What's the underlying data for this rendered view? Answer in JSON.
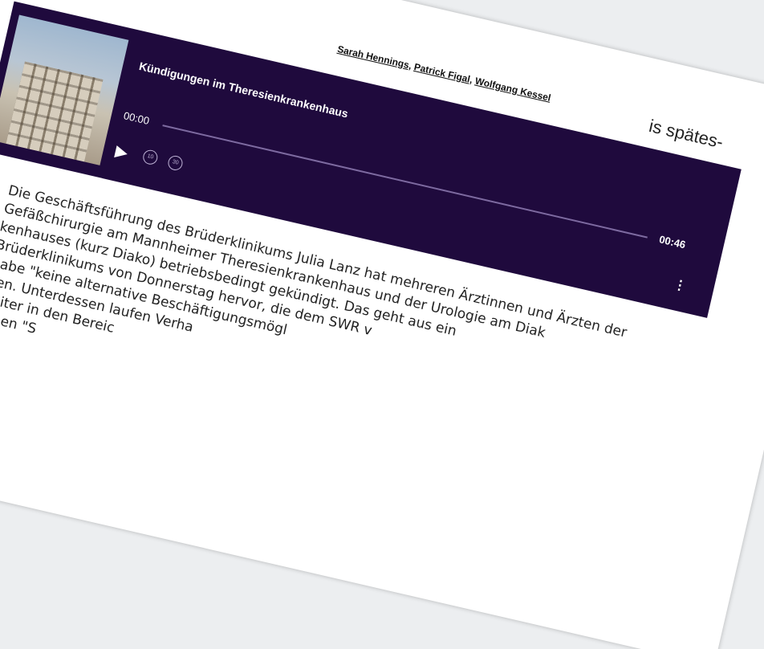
{
  "byline": {
    "authors": [
      "Sarah Hennings",
      "Patrick Figal",
      "Wolfgang Kessel"
    ],
    "separator": ", ",
    "side_text": "is spätes-"
  },
  "player": {
    "title": "Kündigungen im Theresienkrankenhaus",
    "current_time": "00:00",
    "total_time": "00:46",
    "progress": 0,
    "play_icon": "play-icon",
    "rewind_label": "10",
    "forward_label": "30",
    "more_icon": "more-vertical-icon",
    "colors": {
      "background": "#1f0a3d",
      "track": "#7d6aa0",
      "text": "#ffffff"
    }
  },
  "article": {
    "lines": [
      "Die Geschäftsführung des Brüderklinikums Julia Lanz hat mehreren Ärztinnen und Ärzten der",
      "Gefäßchirurgie am Mannheimer Theresienkrankenhaus und der Urologie am Diak",
      "kenhauses (kurz Diako) betriebsbedingt gekündigt. Das geht aus ein",
      "Brüderklinikums von Donnerstag hervor, die dem SWR v",
      "habe \"keine alternative Beschäftigungsmögl",
      "ben. Unterdessen laufen Verha",
      "beiter in den Bereic",
      "fenen \"S"
    ]
  }
}
